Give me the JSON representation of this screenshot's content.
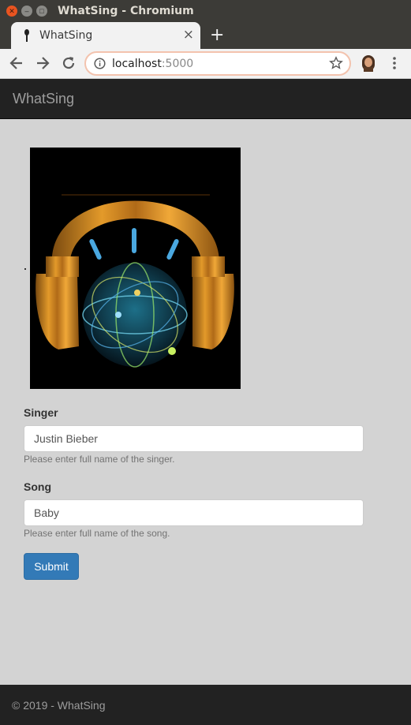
{
  "window": {
    "title": "WhatSing - Chromium"
  },
  "tab": {
    "title": "WhatSing",
    "close": "×",
    "new_tab": "+"
  },
  "address_bar": {
    "host": "localhost",
    "port": ":5000"
  },
  "navbar": {
    "brand": "WhatSing"
  },
  "form": {
    "singer_label": "Singer",
    "singer_value": "Justin Bieber",
    "singer_help": "Please enter full name of the singer.",
    "song_label": "Song",
    "song_value": "Baby",
    "song_help": "Please enter full name of the song.",
    "submit_label": "Submit"
  },
  "footer": {
    "text": "© 2019 - WhatSing"
  },
  "icons": {
    "window_close": "close-icon",
    "window_minimize": "minimize-icon",
    "window_maximize": "maximize-icon",
    "tab_favicon": "microphone-icon",
    "back": "arrow-left-icon",
    "forward": "arrow-right-icon",
    "reload": "reload-icon",
    "site_info": "info-icon",
    "bookmark": "star-icon",
    "profile": "avatar-icon",
    "menu": "kebab-menu-icon"
  },
  "colors": {
    "app_background": "#d3d3d3",
    "navbar": "#222222",
    "primary_button": "#337ab7",
    "omnibox_focus_border": "#f3c3ae"
  }
}
